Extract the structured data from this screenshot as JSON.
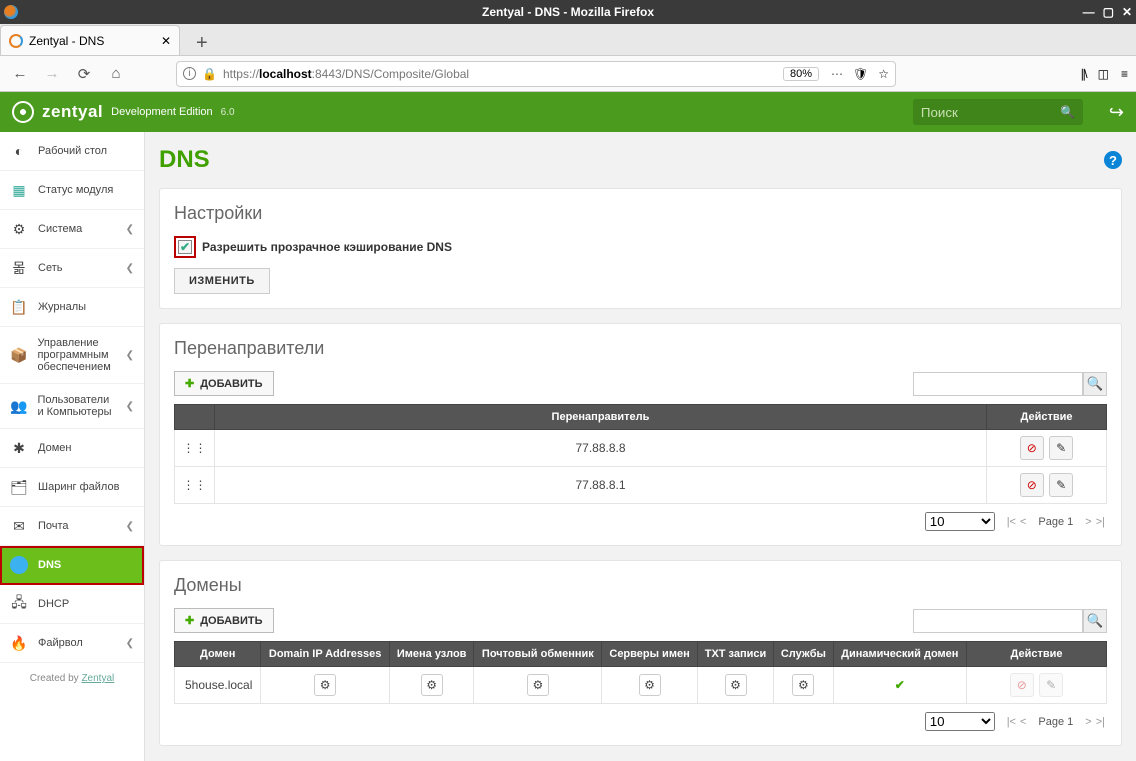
{
  "os": {
    "title": "Zentyal - DNS - Mozilla Firefox"
  },
  "browser": {
    "tab_title": "Zentyal - DNS",
    "url_prefix": "https://",
    "url_host": "localhost",
    "url_port_path": ":8443/DNS/Composite/Global",
    "zoom": "80%"
  },
  "header": {
    "brand": "zentyal",
    "edition": "Development Edition",
    "version": "6.0",
    "search_placeholder": "Поиск"
  },
  "sidebar": {
    "items": [
      {
        "label": "Рабочий стол",
        "chev": false
      },
      {
        "label": "Статус модуля",
        "chev": false
      },
      {
        "label": "Система",
        "chev": true
      },
      {
        "label": "Сеть",
        "chev": true
      },
      {
        "label": "Журналы",
        "chev": false
      },
      {
        "label": "Управление программным обеспечением",
        "chev": true
      },
      {
        "label": "Пользователи и Компьютеры",
        "chev": true
      },
      {
        "label": "Домен",
        "chev": false
      },
      {
        "label": "Шаринг файлов",
        "chev": false
      },
      {
        "label": "Почта",
        "chev": true
      },
      {
        "label": "DNS",
        "chev": false
      },
      {
        "label": "DHCP",
        "chev": false
      },
      {
        "label": "Файрвол",
        "chev": true
      }
    ],
    "credits_prefix": "Created by ",
    "credits_link": "Zentyal"
  },
  "page": {
    "title": "DNS",
    "settings": {
      "heading": "Настройки",
      "checkbox_label": "Разрешить прозрачное кэширование DNS",
      "submit": "ИЗМЕНИТЬ"
    },
    "forwarders": {
      "heading": "Перенаправители",
      "add": "ДОБАВИТЬ",
      "col_forwarder": "Перенаправитель",
      "col_action": "Действие",
      "rows": [
        {
          "ip": "77.88.8.8"
        },
        {
          "ip": "77.88.8.1"
        }
      ],
      "page_size": "10",
      "page_label": "Page 1"
    },
    "domains": {
      "heading": "Домены",
      "add": "ДОБАВИТЬ",
      "cols": {
        "domain": "Домен",
        "ip": "Domain IP Addresses",
        "hosts": "Имена узлов",
        "mx": "Почтовый обменник",
        "ns": "Серверы имен",
        "txt": "TXT записи",
        "srv": "Службы",
        "dyn": "Динамический домен",
        "action": "Действие"
      },
      "rows": [
        {
          "domain": "5house.local"
        }
      ],
      "page_size": "10",
      "page_label": "Page 1"
    }
  }
}
